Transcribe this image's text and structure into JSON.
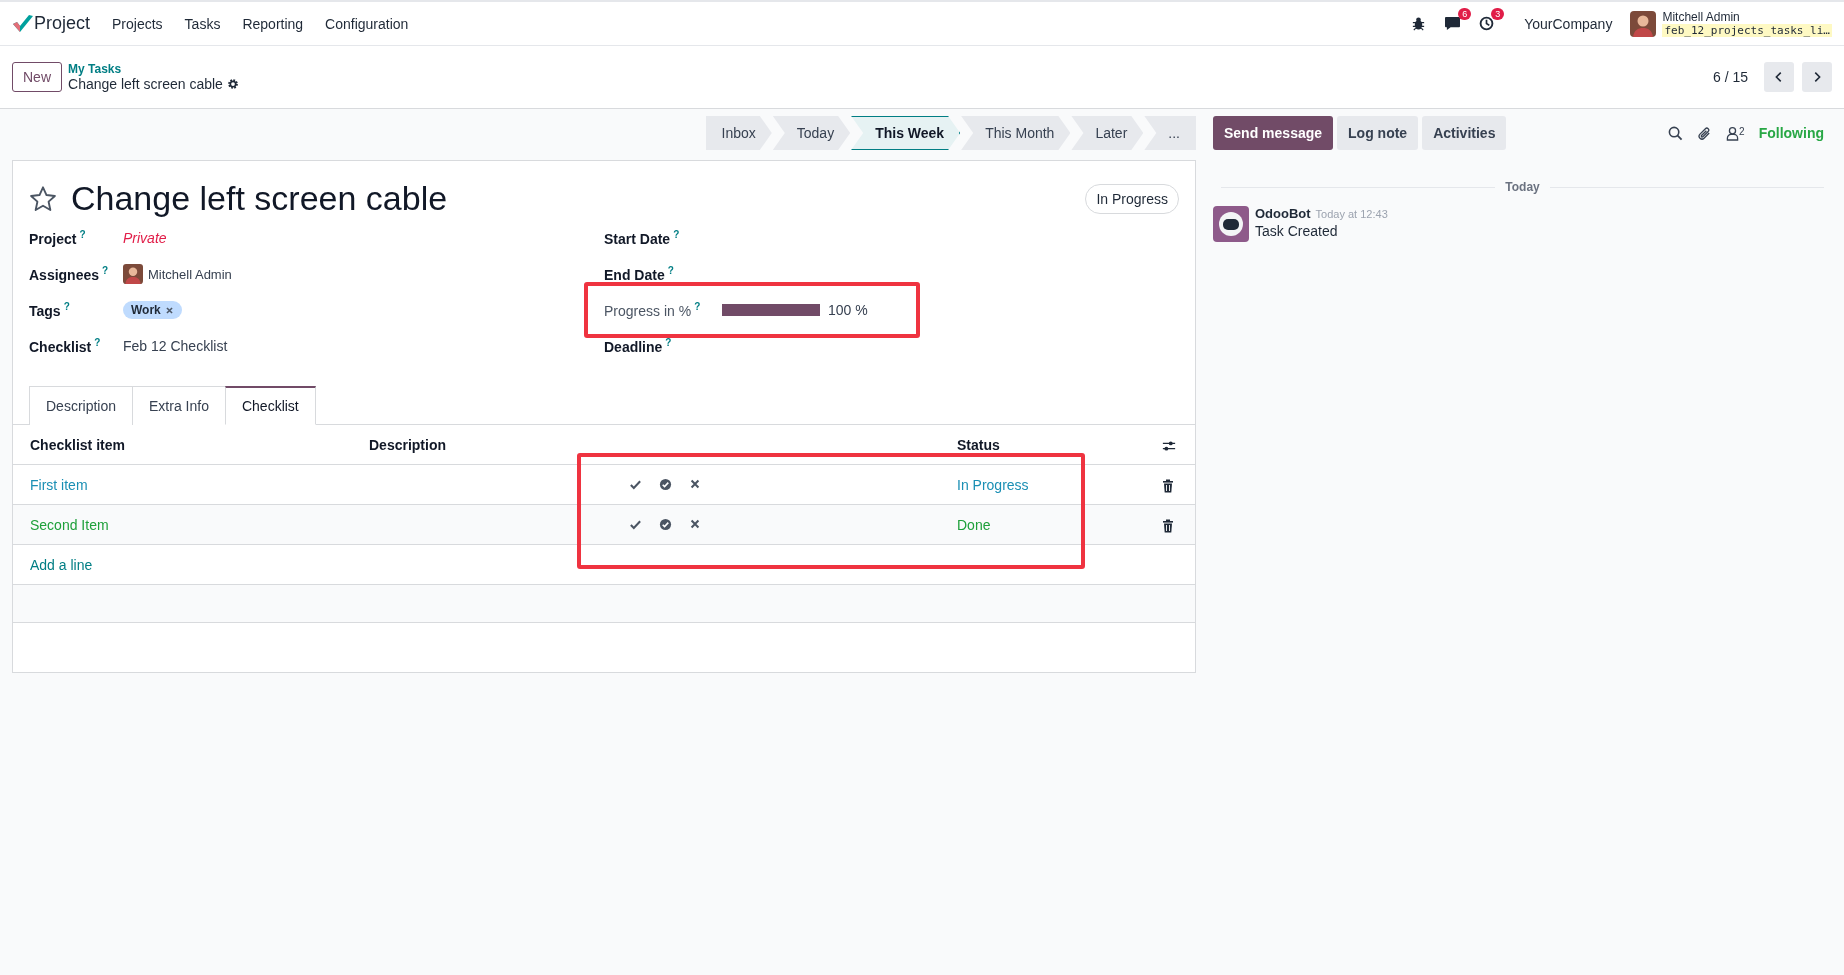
{
  "navbar": {
    "app": "Project",
    "menu": [
      "Projects",
      "Tasks",
      "Reporting",
      "Configuration"
    ],
    "messages_badge": "6",
    "activities_badge": "3",
    "company": "YourCompany",
    "user": "Mitchell Admin",
    "database": "feb_12_projects_tasks_li…"
  },
  "control_panel": {
    "new_button": "New",
    "breadcrumb": "My Tasks",
    "record": "Change left screen cable",
    "pager": "6 / 15"
  },
  "status_bar": [
    {
      "label": "Inbox",
      "selected": false
    },
    {
      "label": "Today",
      "selected": false
    },
    {
      "label": "This Week",
      "selected": true
    },
    {
      "label": "This Month",
      "selected": false
    },
    {
      "label": "Later",
      "selected": false
    },
    {
      "label": "...",
      "selected": false
    }
  ],
  "form": {
    "title": "Change left screen cable",
    "starred": false,
    "state": "In Progress",
    "left_fields": [
      {
        "label": "Project",
        "help": "?",
        "kind": "private",
        "value": "Private"
      },
      {
        "label": "Assignees",
        "help": "?",
        "kind": "avatar",
        "value": "Mitchell Admin"
      },
      {
        "label": "Tags",
        "help": "?",
        "kind": "tags",
        "tags": [
          "Work"
        ]
      },
      {
        "label": "Checklist",
        "help": "?",
        "kind": "text",
        "value": "Feb 12 Checklist"
      }
    ],
    "right_fields": [
      {
        "label": "Start Date",
        "help": "?",
        "kind": "empty"
      },
      {
        "label": "End Date",
        "help": "?",
        "kind": "empty"
      },
      {
        "label": "Progress in %",
        "help": "?",
        "kind": "progress",
        "level": 1,
        "reading": "100 %",
        "highlighted": true
      },
      {
        "label": "Deadline",
        "help": "?",
        "kind": "empty"
      }
    ],
    "tabs": [
      {
        "label": "Description",
        "selected": false
      },
      {
        "label": "Extra Info",
        "selected": false
      },
      {
        "label": "Checklist",
        "selected": true
      }
    ],
    "checklist": {
      "columns": [
        "Checklist item",
        "Description",
        "Status"
      ],
      "actions_highlighted": true,
      "rows": [
        {
          "item": "First item",
          "status": "In Progress",
          "color": "#1a8fb4"
        },
        {
          "item": "Second Item",
          "status": "Done",
          "color": "#1ea03a"
        }
      ],
      "add_line": "Add a line"
    }
  },
  "chatter": {
    "buttons": [
      {
        "label": "Send message",
        "selected": true
      },
      {
        "label": "Log note",
        "selected": false
      },
      {
        "label": "Activities",
        "selected": false
      }
    ],
    "followers": "2",
    "following": "Following",
    "date_separator": "Today",
    "messages": [
      {
        "author": "OdooBot",
        "time": "Today at 12:43",
        "body": "Task Created"
      }
    ]
  }
}
